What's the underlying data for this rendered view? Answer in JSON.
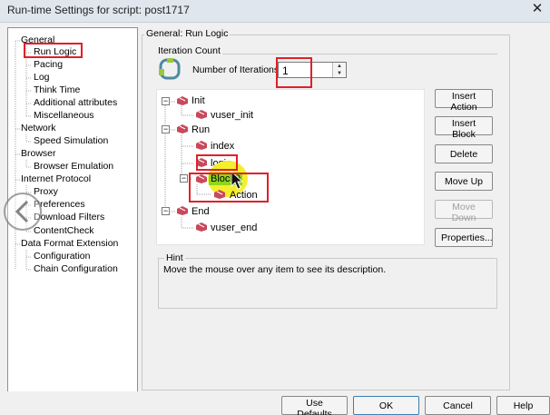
{
  "window": {
    "title": "Run-time Settings for script: post1717",
    "close_glyph": "✕"
  },
  "left_tree": [
    {
      "label": "General"
    },
    {
      "label": "Run Logic"
    },
    {
      "label": "Pacing"
    },
    {
      "label": "Log"
    },
    {
      "label": "Think Time"
    },
    {
      "label": "Additional attributes"
    },
    {
      "label": "Miscellaneous"
    },
    {
      "label": "Network"
    },
    {
      "label": "Speed Simulation"
    },
    {
      "label": "Browser"
    },
    {
      "label": "Browser Emulation"
    },
    {
      "label": "Internet Protocol"
    },
    {
      "label": "Proxy"
    },
    {
      "label": "Preferences"
    },
    {
      "label": "Download Filters"
    },
    {
      "label": "ContentCheck"
    },
    {
      "label": "Data Format Extension"
    },
    {
      "label": "Configuration"
    },
    {
      "label": "Chain Configuration"
    }
  ],
  "panel": {
    "title": "General: Run Logic",
    "iteration_group": "Iteration Count",
    "iterations_label": "Number of Iterations:",
    "iterations_value": "1",
    "expand_minus": "−"
  },
  "script_tree": {
    "init": "Init",
    "vuser_init": "vuser_init",
    "run": "Run",
    "index": "index",
    "login": "login",
    "block0": "Block0",
    "action": "Action",
    "end": "End",
    "vuser_end": "vuser_end"
  },
  "buttons": {
    "insert_action": "Insert Action",
    "insert_block": "Insert Block",
    "delete": "Delete",
    "move_up": "Move Up",
    "move_down": "Move Down",
    "properties": "Properties..."
  },
  "hint": {
    "label": "Hint",
    "text": "Move the mouse over any item to see its description."
  },
  "bottom": {
    "use_defaults": "Use Defaults",
    "ok": "OK",
    "cancel": "Cancel",
    "help": "Help"
  },
  "colors": {
    "highlight_red": "#e0202a",
    "cursor_yellow": "#f5ee2c"
  }
}
